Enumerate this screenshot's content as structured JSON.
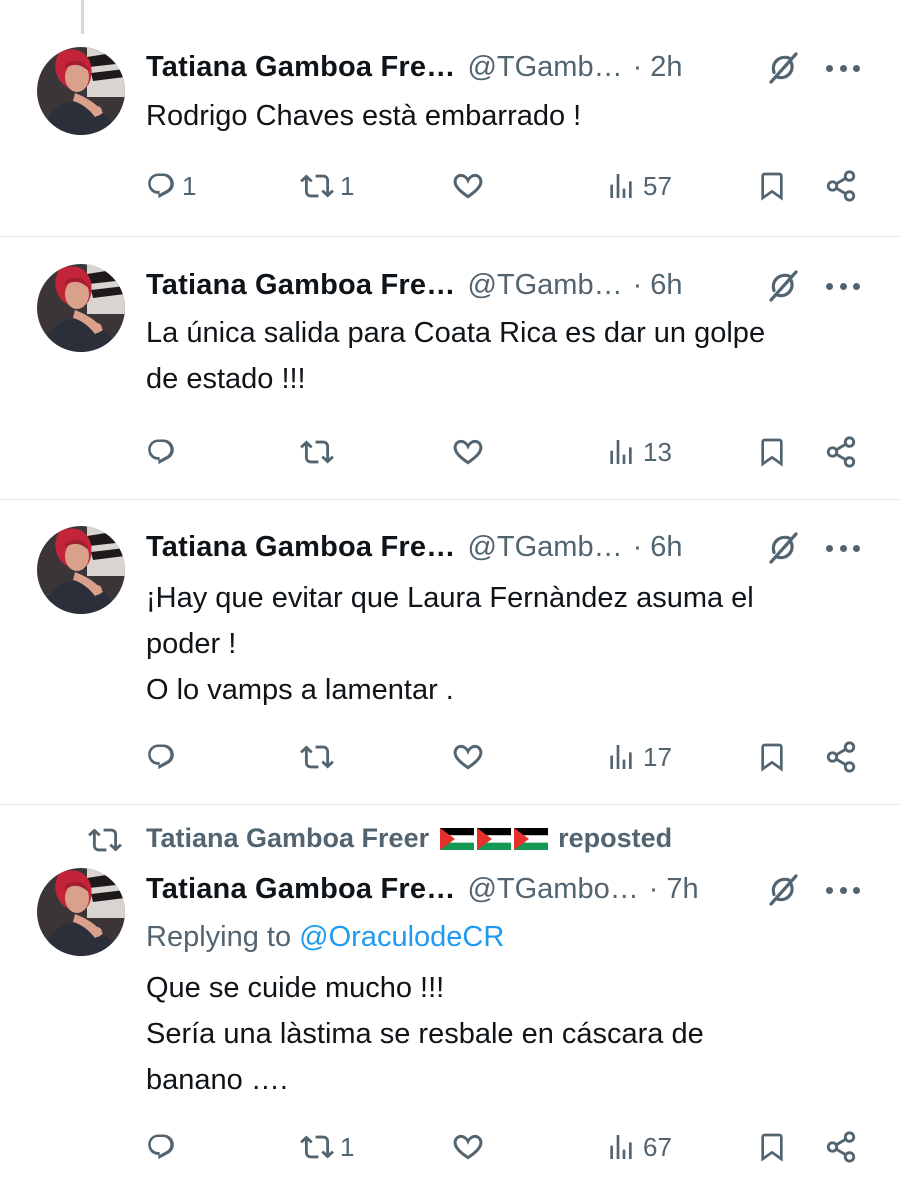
{
  "tweets": [
    {
      "author": "Tatiana Gamboa Fre…",
      "handle": "@TGamb…",
      "time": "· 2h",
      "text_lines": [
        "Rodrigo Chaves està embarrado !"
      ],
      "counts": {
        "replies": "1",
        "reposts": "1",
        "likes": "",
        "views": "57"
      }
    },
    {
      "author": "Tatiana Gamboa Fre…",
      "handle": "@TGamb…",
      "time": "· 6h",
      "text_lines": [
        "La única salida para Coata Rica es dar un golpe",
        "de estado !!!"
      ],
      "counts": {
        "replies": "",
        "reposts": "",
        "likes": "",
        "views": "13"
      }
    },
    {
      "author": "Tatiana Gamboa Fre…",
      "handle": "@TGamb…",
      "time": "· 6h",
      "text_lines": [
        "¡Hay que evitar que Laura Fernàndez asuma el",
        "poder !",
        "O lo vamps a lamentar ."
      ],
      "counts": {
        "replies": "",
        "reposts": "",
        "likes": "",
        "views": "17"
      }
    },
    {
      "repost_by": "Tatiana Gamboa Freer",
      "repost_label": "reposted",
      "author": "Tatiana Gamboa Fre…",
      "handle": "@TGambo…",
      "time": "· 7h",
      "replying_prefix": "Replying to",
      "replying_to": "@OraculodeCR",
      "text_lines": [
        "Que se cuide mucho !!!",
        "Sería una làstima se resbale en cáscara de",
        "banano …."
      ],
      "counts": {
        "replies": "",
        "reposts": "1",
        "likes": "",
        "views": "67"
      }
    }
  ],
  "icons": {
    "reply": "reply-icon",
    "repost": "repost-icon",
    "like": "heart-icon",
    "views": "views-icon",
    "bookmark": "bookmark-icon",
    "share": "share-icon",
    "grok": "grok-icon",
    "more": "more-icon",
    "flag": "palestine-flag-icon"
  },
  "colors": {
    "text": "#0f1419",
    "secondary": "#536471",
    "link": "#1d9bf0",
    "divider": "#e7ebee"
  }
}
